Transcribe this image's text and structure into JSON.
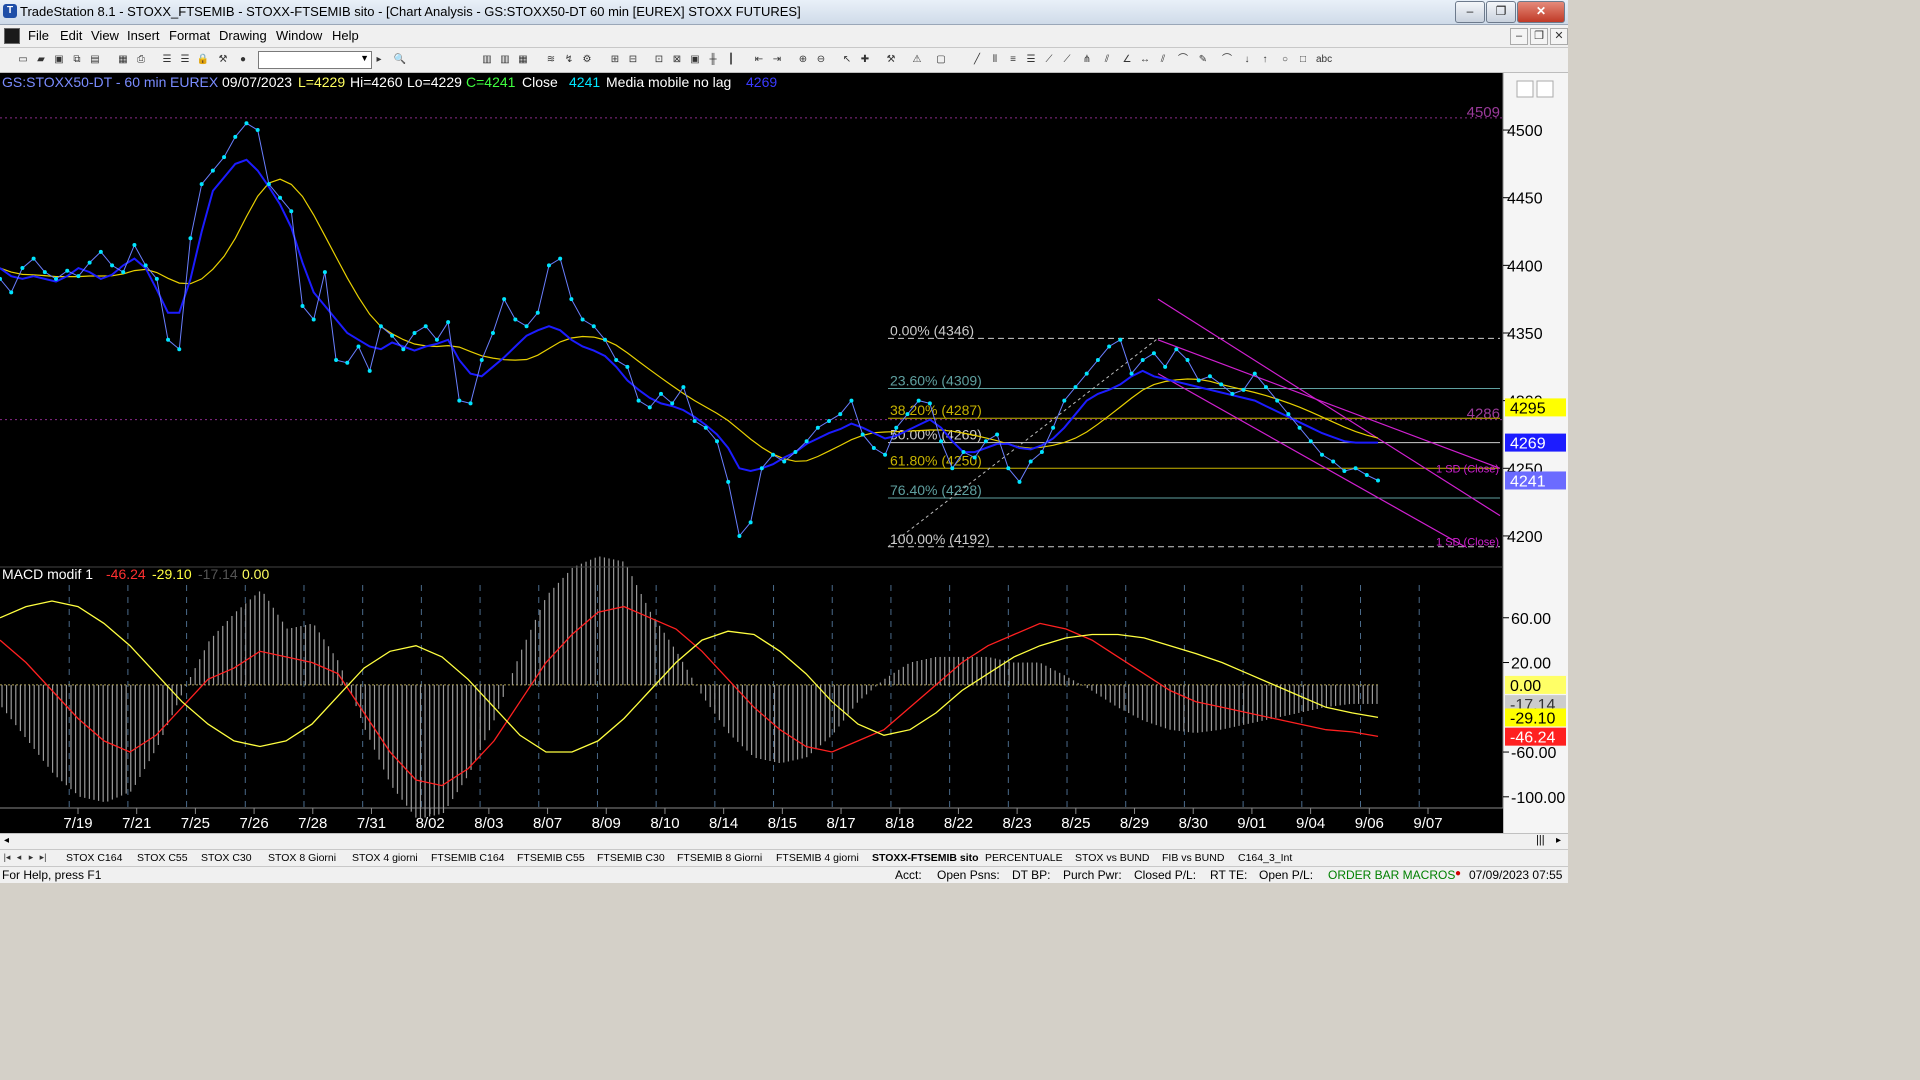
{
  "window": {
    "title": "TradeStation 8.1 - STOXX_FTSEMIB - STOXX-FTSEMIB sito - [Chart Analysis - GS:STOXX50-DT  60 min  [EUREX] STOXX FUTURES]",
    "min_label": "–",
    "max_label": "❐",
    "close_label": "✕"
  },
  "menu": {
    "items": [
      "File",
      "Edit",
      "View",
      "Insert",
      "Format",
      "Drawing",
      "Window",
      "Help"
    ]
  },
  "chart_header": {
    "symbol": "GS:STOXX50-DT - 60 min",
    "exchange": "EUREX",
    "date": "09/07/2023",
    "low_label": "L=4229",
    "high_label": "Hi=4260",
    "lo_label": "Lo=4229",
    "close_label": "C=4241",
    "close_word": "Close",
    "close_value": "4241",
    "ma_name": "Media mobile no lag",
    "ma_value": "4269"
  },
  "macd_header": {
    "name": "MACD modif 1",
    "v1": "-46.24",
    "v2": "-29.10",
    "v3": "-17.14",
    "v4": "0.00"
  },
  "chart_data": [
    {
      "type": "line",
      "title": "GS:STOXX50-DT - 60 min",
      "x_tick_labels": [
        "7/19",
        "7/21",
        "7/25",
        "7/26",
        "7/28",
        "7/31",
        "8/02",
        "8/03",
        "8/07",
        "8/09",
        "8/10",
        "8/14",
        "8/15",
        "8/17",
        "8/18",
        "8/22",
        "8/23",
        "8/25",
        "8/29",
        "8/30",
        "9/01",
        "9/04",
        "9/06",
        "9/07"
      ],
      "ylim": [
        4180,
        4520
      ],
      "y_ticks": [
        4200,
        4250,
        4300,
        4350,
        4400,
        4450,
        4500
      ],
      "series": [
        {
          "values": [
            4390,
            4380,
            4398,
            4405,
            4395,
            4390,
            4396,
            4392,
            4402,
            4410,
            4400,
            4395,
            4415,
            4400,
            4390,
            4345,
            4338,
            4420,
            4460,
            4470,
            4480,
            4495,
            4505,
            4500,
            4460,
            4450,
            4440,
            4370,
            4360,
            4395,
            4330,
            4328,
            4340,
            4322,
            4355,
            4348,
            4338,
            4350,
            4355,
            4345,
            4358,
            4300,
            4298,
            4330,
            4350,
            4375,
            4360,
            4355,
            4365,
            4400,
            4405,
            4375,
            4360,
            4355,
            4345,
            4330,
            4325,
            4300,
            4295,
            4305,
            4298,
            4310,
            4285,
            4280,
            4270,
            4240,
            4200,
            4210,
            4250,
            4260,
            4255,
            4262,
            4270,
            4280,
            4285,
            4290,
            4300,
            4275,
            4265,
            4260,
            4280,
            4290,
            4300,
            4298,
            4270,
            4250,
            4262,
            4258,
            4270,
            4275,
            4250,
            4240,
            4255,
            4262,
            4280,
            4300,
            4310,
            4320,
            4330,
            4340,
            4345,
            4320,
            4330,
            4335,
            4325,
            4338,
            4330,
            4315,
            4318,
            4312,
            4305,
            4308,
            4320,
            4310,
            4300,
            4290,
            4280,
            4270,
            4260,
            4255,
            4248,
            4250,
            4245,
            4241
          ]
        },
        {
          "name": "Media mobile no lag",
          "values": [
            4398,
            4392,
            4390,
            4392,
            4390,
            4388,
            4392,
            4398,
            4395,
            4390,
            4393,
            4400,
            4405,
            4398,
            4382,
            4365,
            4365,
            4390,
            4425,
            4455,
            4465,
            4475,
            4478,
            4470,
            4458,
            4445,
            4428,
            4402,
            4380,
            4370,
            4360,
            4350,
            4345,
            4340,
            4338,
            4343,
            4340,
            4337,
            4340,
            4342,
            4345,
            4330,
            4320,
            4318,
            4325,
            4332,
            4340,
            4348,
            4352,
            4355,
            4352,
            4345,
            4340,
            4337,
            4333,
            4325,
            4315,
            4308,
            4302,
            4298,
            4296,
            4293,
            4288,
            4282,
            4275,
            4265,
            4250,
            4248,
            4250,
            4253,
            4258,
            4262,
            4268,
            4272,
            4276,
            4279,
            4283,
            4280,
            4276,
            4272,
            4274,
            4278,
            4282,
            4286,
            4280,
            4270,
            4262,
            4262,
            4265,
            4268,
            4268,
            4265,
            4264,
            4267,
            4272,
            4280,
            4290,
            4300,
            4305,
            4308,
            4312,
            4318,
            4322,
            4318,
            4316,
            4314,
            4312,
            4310,
            4308,
            4306,
            4304,
            4302,
            4300,
            4296,
            4292,
            4288,
            4284,
            4280,
            4276,
            4273,
            4270,
            4269,
            4269,
            4269
          ]
        }
      ],
      "fibonacci": {
        "levels": [
          "0.00% (4346)",
          "23.60% (4309)",
          "38.20% (4287)",
          "50.00% (4269)",
          "61.80% (4250)",
          "76.40% (4228)",
          "100.00% (4192)"
        ],
        "values": [
          4346,
          4309,
          4287,
          4269,
          4250,
          4228,
          4192
        ]
      },
      "regression_channel_labels": [
        "1 SD (Close)",
        "1 SD (Close)"
      ],
      "price_markers": {
        "top": "4509",
        "mid": "4286",
        "yellow": "4295",
        "blue": "4269",
        "last": "4241"
      }
    },
    {
      "type": "line",
      "title": "MACD modif 1",
      "ylim": [
        -110,
        100
      ],
      "y_ticks": [
        60,
        20,
        -60,
        -100
      ],
      "series": [
        {
          "name": "MACD",
          "values": [
            40,
            20,
            -5,
            -30,
            -50,
            -60,
            -45,
            -20,
            5,
            15,
            30,
            25,
            20,
            10,
            -25,
            -60,
            -85,
            -90,
            -75,
            -50,
            -15,
            20,
            45,
            65,
            70,
            60,
            50,
            30,
            5,
            -20,
            -40,
            -55,
            -60,
            -50,
            -40,
            -20,
            0,
            20,
            35,
            45,
            55,
            50,
            40,
            25,
            10,
            -5,
            -15,
            -20,
            -25,
            -30,
            -35,
            -40,
            -42,
            -46
          ]
        },
        {
          "name": "Signal",
          "values": [
            60,
            70,
            75,
            70,
            55,
            35,
            10,
            -15,
            -35,
            -50,
            -55,
            -50,
            -35,
            -10,
            15,
            30,
            35,
            25,
            5,
            -20,
            -45,
            -60,
            -60,
            -50,
            -30,
            -5,
            20,
            40,
            48,
            45,
            30,
            10,
            -15,
            -35,
            -45,
            -40,
            -25,
            -5,
            10,
            25,
            35,
            42,
            45,
            45,
            42,
            35,
            28,
            20,
            10,
            0,
            -10,
            -20,
            -25,
            -29
          ]
        },
        {
          "name": "Histogram",
          "values": [
            -20,
            -50,
            -80,
            -100,
            -105,
            -95,
            -55,
            -5,
            40,
            65,
            85,
            50,
            55,
            20,
            -40,
            -90,
            -120,
            -115,
            -80,
            -30,
            30,
            80,
            105,
            115,
            110,
            65,
            30,
            -10,
            -43,
            -65,
            -70,
            -65,
            -45,
            -15,
            5,
            20,
            25,
            25,
            25,
            20,
            20,
            8,
            -5,
            -20,
            -32,
            -40,
            -43,
            -40,
            -35,
            -30,
            -25,
            -20,
            -17,
            -17
          ]
        }
      ],
      "price_markers": {
        "zero": "0.00",
        "hist": "-17.14",
        "signal": "-29.10",
        "macd": "-46.24"
      }
    }
  ],
  "sheet_tabs": [
    "STOX C164",
    "STOX C55",
    "STOX  C30",
    "STOX  8 Giorni",
    "STOX 4 giorni",
    "FTSEMIB C164",
    "FTSEMIB C55",
    "FTSEMIB C30",
    "FTSEMIB  8 Giorni",
    "FTSEMIB  4 giorni",
    "STOXX-FTSEMIB sito",
    "PERCENTUALE",
    "STOX vs BUND",
    "FIB vs BUND",
    "C164_3_Int"
  ],
  "statusbar": {
    "help": "For Help, press F1",
    "acct": "Acct:",
    "open_psns": "Open Psns:",
    "dt_bp": "DT BP:",
    "purch_pwr": "Purch Pwr:",
    "closed_pl": "Closed P/L:",
    "rt_te": "RT TE:",
    "open_pl": "Open P/L:",
    "macros": "ORDER BAR  MACROS",
    "datetime": "07/09/2023 07:55"
  },
  "colors": {
    "price": "#00e5ff",
    "ma_blue": "#1c1cff",
    "ma_yellow": "#e8d000",
    "macd": "#ff2020",
    "signal": "#ffff40",
    "channel": "#d020d0",
    "fib": "#6aa0a0"
  }
}
